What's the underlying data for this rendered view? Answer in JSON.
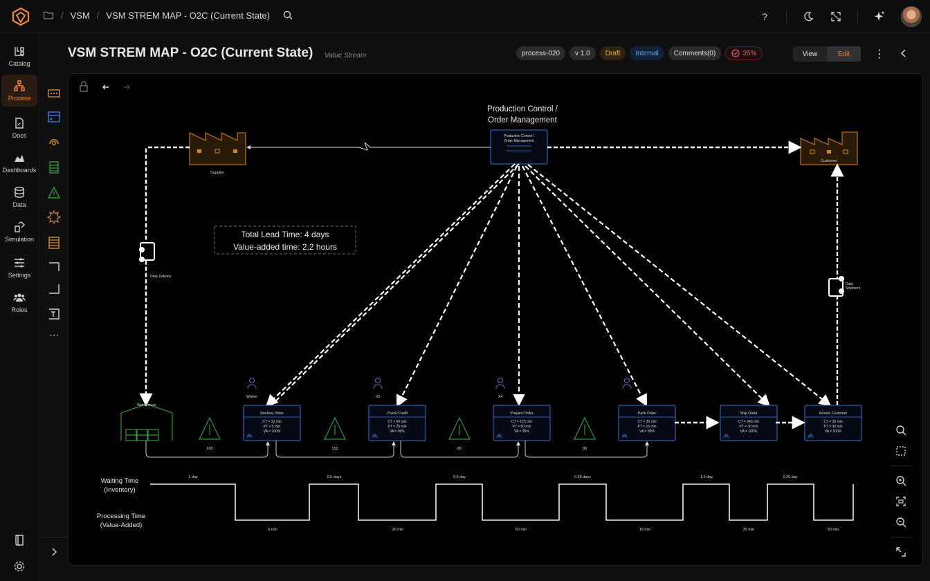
{
  "app": {
    "breadcrumbs": [
      "VSM",
      "VSM STREM MAP - O2C (Current State)"
    ]
  },
  "nav": {
    "items": [
      {
        "label": "Catalog"
      },
      {
        "label": "Process"
      },
      {
        "label": "Docs"
      },
      {
        "label": "Dashboards"
      },
      {
        "label": "Data"
      },
      {
        "label": "Simulation"
      },
      {
        "label": "Settings"
      },
      {
        "label": "Roles"
      }
    ]
  },
  "header": {
    "title": "VSM STREM MAP - O2C (Current State)",
    "subtitle": "Value Stream",
    "badges": {
      "process_id": "process-020",
      "version": "v 1.0",
      "status": "Draft",
      "visibility": "Internal",
      "comments": "Comments(0)",
      "progress": "35%"
    },
    "view_label": "View",
    "edit_label": "Edit"
  },
  "diagram": {
    "production_control_title_line1": "Production Control /",
    "production_control_title_line2": "Order Management",
    "production_control_box_line1": "Production Control /",
    "production_control_box_line2": "Order Management",
    "supplier_label": "Supplier",
    "customer_label": "Customer",
    "warehouse_label": "Warehouse",
    "daily_delivery_label": "Daily Delivery",
    "daily_shipment_line1": "Daily",
    "daily_shipment_line2": "Shipment",
    "lead_time": "Total Lead Time: 4 days",
    "value_added": "Value-added time: 2.2 hours",
    "operators": [
      "Worker",
      "X3",
      "X4",
      "",
      ""
    ],
    "processes": [
      {
        "name": "Receive Order",
        "ct": "CT = 10 min",
        "pt": "PT = 5 min",
        "va": "VA = 100%"
      },
      {
        "name": "Check Credit",
        "ct": "CT = 60 min",
        "pt": "PT = 20 min",
        "va": "VA = 90%"
      },
      {
        "name": "Prepare Order",
        "ct": "CT = 120 min",
        "pt": "PT = 60 min",
        "va": "VA = 95%"
      },
      {
        "name": "Pack Order",
        "ct": "CT = 30 min",
        "pt": "PT = 15 min",
        "va": "VA = 95%"
      },
      {
        "name": "Ship Order",
        "ct": "CT = 240 min",
        "pt": "PT = 30 min",
        "va": "VA = 100%"
      },
      {
        "name": "Invoice Customer",
        "ct": "CT = 30 min",
        "pt": "PT = 30 min",
        "va": "VA = 100%"
      }
    ],
    "inventory": [
      "200",
      "150",
      "80",
      "30"
    ],
    "timeline": {
      "waiting_label_1": "Waiting Time",
      "waiting_label_2": "(Inventory)",
      "processing_label_1": "Processing Time",
      "processing_label_2": "(Value-Added)",
      "waits": [
        "1 day",
        "0.5 days",
        "0.5 day",
        "0.25 days",
        "1.5 day",
        "0.25 day"
      ],
      "processing": [
        "5 min",
        "20 min",
        "60 min",
        "15 min",
        "30 min",
        "30 min"
      ]
    }
  },
  "colors": {
    "accent": "#f08a3c",
    "process_border": "#2e5fb0",
    "factory": "#c77a1a",
    "inventory": "#2d9a3a"
  }
}
